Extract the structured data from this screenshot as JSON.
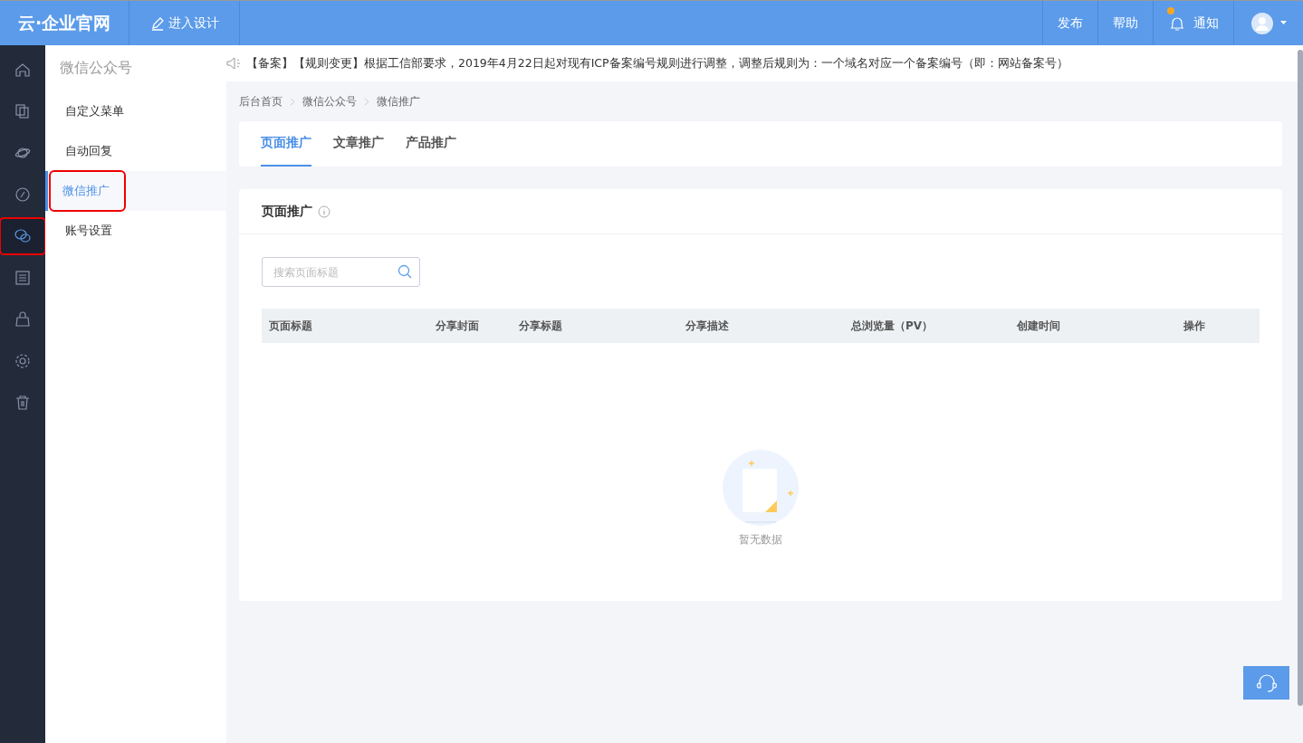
{
  "topbar": {
    "logo": "云·企业官网",
    "design_button": "进入设计",
    "actions": [
      {
        "kind": "text",
        "label": "发布"
      },
      {
        "kind": "text",
        "label": "帮助"
      },
      {
        "kind": "notify",
        "label": "通知",
        "unread": true
      }
    ],
    "user": {
      "kind": "avatar"
    }
  },
  "rail": {
    "items": [
      {
        "selected": false,
        "highlighted": false
      },
      {
        "selected": false,
        "highlighted": false
      },
      {
        "selected": false,
        "highlighted": false
      },
      {
        "selected": false,
        "highlighted": false
      },
      {
        "selected": true,
        "highlighted": true
      },
      {
        "selected": false,
        "highlighted": false
      },
      {
        "selected": false,
        "highlighted": false
      },
      {
        "selected": false,
        "highlighted": false
      },
      {
        "selected": false,
        "highlighted": false
      }
    ]
  },
  "subnav": {
    "title": "微信公众号",
    "items": [
      {
        "label": "自定义菜单",
        "selected": false,
        "highlighted": false
      },
      {
        "label": "自动回复",
        "selected": false,
        "highlighted": false
      },
      {
        "label": "微信推广",
        "selected": true,
        "highlighted": true
      },
      {
        "label": "账号设置",
        "selected": false,
        "highlighted": false
      }
    ]
  },
  "notice": "【备案】【规则变更】根据工信部要求，2019年4月22日起对现有ICP备案编号规则进行调整，调整后规则为：一个域名对应一个备案编号（即：网站备案号）",
  "breadcrumb": [
    "后台首页",
    "微信公众号",
    "微信推广"
  ],
  "tabs": [
    {
      "label": "页面推广",
      "selected": true
    },
    {
      "label": "文章推广",
      "selected": false
    },
    {
      "label": "产品推广",
      "selected": false
    }
  ],
  "panel": {
    "title": "页面推广",
    "search": {
      "placeholder": "搜索页面标题"
    },
    "table": {
      "columns": [
        "页面标题",
        "分享封面",
        "分享标题",
        "分享描述",
        "总浏览量（PV）",
        "创建时间",
        "操作"
      ]
    },
    "empty_text": "暂无数据"
  }
}
